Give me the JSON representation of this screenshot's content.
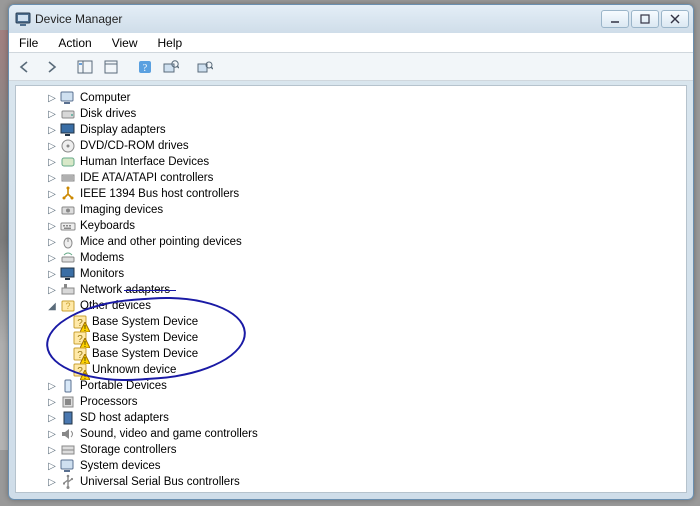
{
  "window": {
    "title": "Device Manager"
  },
  "menu": {
    "file": "File",
    "action": "Action",
    "view": "View",
    "help": "Help"
  },
  "tree": {
    "items": [
      {
        "label": "Computer",
        "icon": "computer",
        "exp": "▷"
      },
      {
        "label": "Disk drives",
        "icon": "disk",
        "exp": "▷"
      },
      {
        "label": "Display adapters",
        "icon": "display",
        "exp": "▷"
      },
      {
        "label": "DVD/CD-ROM drives",
        "icon": "dvd",
        "exp": "▷"
      },
      {
        "label": "Human Interface Devices",
        "icon": "hid",
        "exp": "▷"
      },
      {
        "label": "IDE ATA/ATAPI controllers",
        "icon": "ide",
        "exp": "▷"
      },
      {
        "label": "IEEE 1394 Bus host controllers",
        "icon": "ieee",
        "exp": "▷"
      },
      {
        "label": "Imaging devices",
        "icon": "imaging",
        "exp": "▷"
      },
      {
        "label": "Keyboards",
        "icon": "keyboard",
        "exp": "▷"
      },
      {
        "label": "Mice and other pointing devices",
        "icon": "mouse",
        "exp": "▷"
      },
      {
        "label": "Modems",
        "icon": "modem",
        "exp": "▷"
      },
      {
        "label": "Monitors",
        "icon": "monitor",
        "exp": "▷"
      },
      {
        "label": "Network adapters",
        "icon": "network",
        "exp": "▷"
      },
      {
        "label": "Other devices",
        "icon": "other",
        "exp": "◢"
      }
    ],
    "other_children": [
      {
        "label": "Base System Device"
      },
      {
        "label": "Base System Device"
      },
      {
        "label": "Base System Device"
      },
      {
        "label": "Unknown device"
      }
    ],
    "items2": [
      {
        "label": "Portable Devices",
        "icon": "portable",
        "exp": "▷"
      },
      {
        "label": "Processors",
        "icon": "cpu",
        "exp": "▷"
      },
      {
        "label": "SD host adapters",
        "icon": "sd",
        "exp": "▷"
      },
      {
        "label": "Sound, video and game controllers",
        "icon": "sound",
        "exp": "▷"
      },
      {
        "label": "Storage controllers",
        "icon": "storage",
        "exp": "▷"
      },
      {
        "label": "System devices",
        "icon": "system",
        "exp": "▷"
      },
      {
        "label": "Universal Serial Bus controllers",
        "icon": "usb",
        "exp": "▷"
      }
    ]
  }
}
